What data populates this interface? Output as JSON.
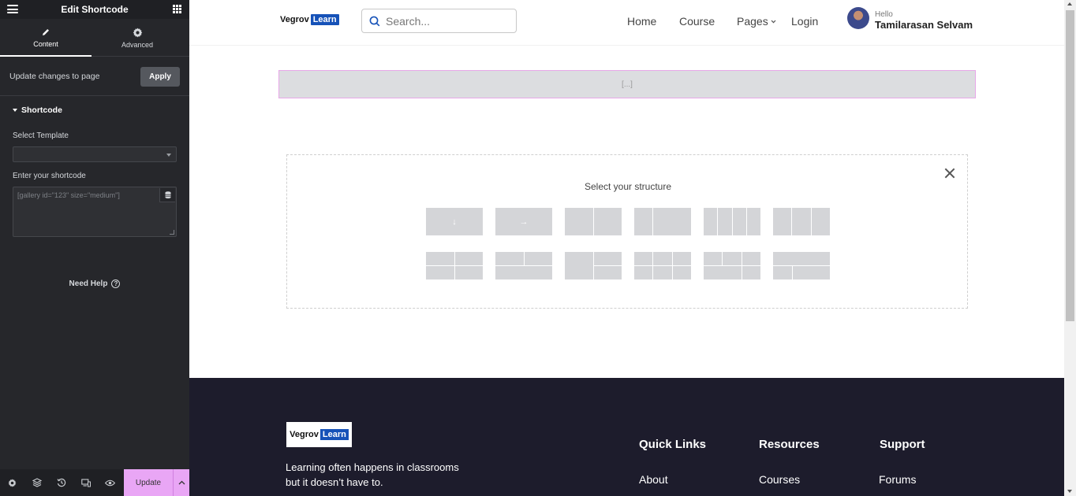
{
  "editor": {
    "title": "Edit Shortcode",
    "tabs": [
      {
        "label": "Content",
        "icon": "pencil-icon",
        "active": true
      },
      {
        "label": "Advanced",
        "icon": "gear-icon",
        "active": false
      }
    ],
    "update_changes_text": "Update changes to page",
    "apply_label": "Apply",
    "section_title": "Shortcode",
    "select_template_label": "Select Template",
    "select_template_value": "",
    "shortcode_label": "Enter your shortcode",
    "shortcode_placeholder": "[gallery id=\"123\" size=\"medium\"]",
    "need_help": "Need Help",
    "footer_icons": [
      "settings-icon",
      "layers-icon",
      "history-icon",
      "responsive-icon",
      "preview-eye-icon"
    ],
    "update_label": "Update",
    "colors": {
      "panel_bg": "#26272b",
      "update_accent": "#e9a6f5"
    }
  },
  "site": {
    "logo": {
      "word1": "Vegrov",
      "word2": "Learn"
    },
    "search_placeholder": "Search...",
    "nav": [
      "Home",
      "Course",
      "Pages",
      "Login"
    ],
    "user": {
      "greeting": "Hello",
      "name": "Tamilarasan Selvam"
    },
    "shortcode_preview": "[...]",
    "structure": {
      "title": "Select your structure",
      "presets_row1": [
        "single-column",
        "two-columns-horizontal",
        "two-columns",
        "two-columns-unequal",
        "four-columns",
        "three-columns"
      ],
      "presets_row2": [
        "grid-2x2",
        "two-over-one",
        "one-plus-two-stacked",
        "grid-3x2",
        "grid-3x2-alt",
        "grid-2x2-unequal"
      ]
    },
    "footer": {
      "tagline": "Learning often happens in classrooms but it doesn’t have to.",
      "columns": [
        {
          "title": "Quick Links",
          "first_link": "About"
        },
        {
          "title": "Resources",
          "first_link": "Courses"
        },
        {
          "title": "Support",
          "first_link": "Forums"
        }
      ]
    },
    "colors": {
      "brand_blue": "#1652b8",
      "footer_bg": "#1d1c2c"
    }
  }
}
